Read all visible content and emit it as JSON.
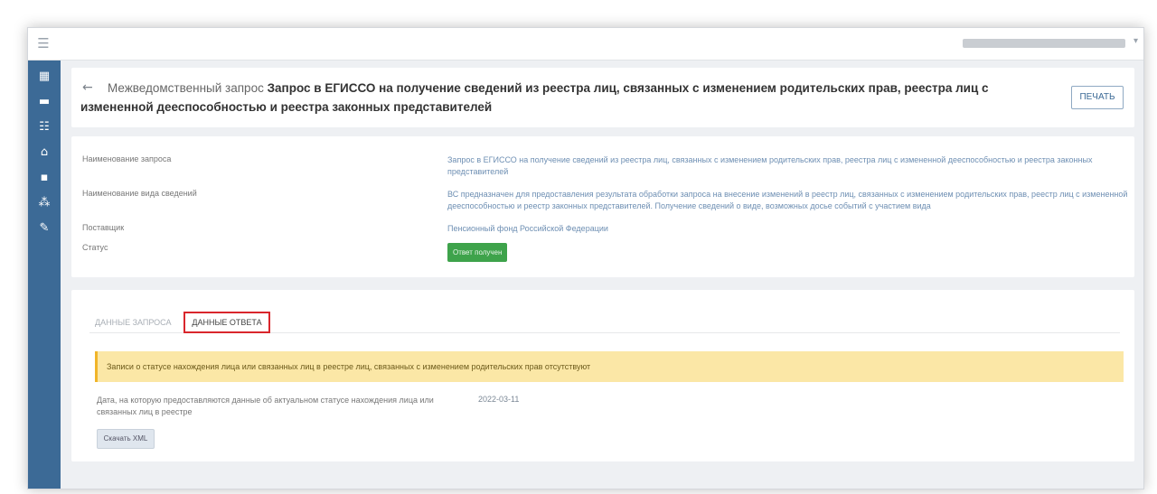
{
  "topbar": {
    "menu_icon": "hamburger-icon",
    "user_caret": "▾"
  },
  "sidebar": {
    "icons": [
      "dashboard-icon",
      "inbox-icon",
      "users-icon",
      "briefcase-icon",
      "chat-icon",
      "network-icon",
      "edit-icon"
    ]
  },
  "header": {
    "back_icon": "arrow-left-icon",
    "title_prefix": "Межведомственный запрос",
    "title_main": "Запрос в ЕГИССО на получение сведений из реестра лиц, связанных с изменением родительских прав, реестра лиц с измененной дееспособностью и реестра законных представителей",
    "print_label": "ПЕЧАТЬ"
  },
  "info": {
    "rows": [
      {
        "label": "Наименование запроса",
        "value": "Запрос в ЕГИССО на получение сведений из реестра лиц, связанных с изменением родительских прав, реестра лиц с измененной дееспособностью и реестра законных представителей"
      },
      {
        "label": "Наименование вида сведений",
        "value": "ВС предназначен для предоставления результата обработки запроса на внесение изменений в реестр лиц, связанных с изменением родительских прав, реестр лиц с измененной дееспособностью и реестр законных представителей. Получение сведений о виде, возможных досье событий с участием вида"
      },
      {
        "label": "Поставщик",
        "value": "Пенсионный фонд Российской Федерации"
      },
      {
        "label": "Статус",
        "value": "Ответ получен"
      }
    ]
  },
  "tabs": {
    "request_label": "ДАННЫЕ ЗАПРОСА",
    "response_label": "ДАННЫЕ ОТВЕТА"
  },
  "response": {
    "alert_text": "Записи о статусе нахождения лица или связанных лиц в реестре лиц, связанных с изменением родительских прав отсутствуют",
    "date_label": "Дата, на которую предоставляются данные об актуальном статусе нахождения лица или связанных лиц в реестре",
    "date_value": "2022-03-11",
    "xml_button_label": "Скачать XML"
  },
  "colors": {
    "sidebar": "#3c6a96",
    "status_badge": "#3ea34b",
    "alert_bg": "#fbe7a6",
    "highlight_box": "#d9262c"
  }
}
